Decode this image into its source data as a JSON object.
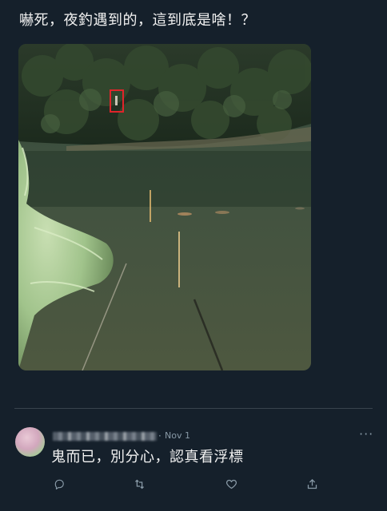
{
  "post": {
    "text": "嚇死，夜釣遇到的，這到底是啥！？"
  },
  "photo": {
    "highlight_color": "#e0242a",
    "icon": "fishing-night-photo"
  },
  "reply": {
    "separator": "·",
    "date": "Nov 1",
    "more_label": "···",
    "text": "鬼而已，別分心，認真看浮標"
  },
  "actions": {
    "reply_icon": "comment-icon",
    "retweet_icon": "retweet-icon",
    "like_icon": "heart-icon",
    "share_icon": "share-icon"
  },
  "colors": {
    "background": "#15202b",
    "muted": "#8899a6",
    "divider": "#38444d"
  }
}
